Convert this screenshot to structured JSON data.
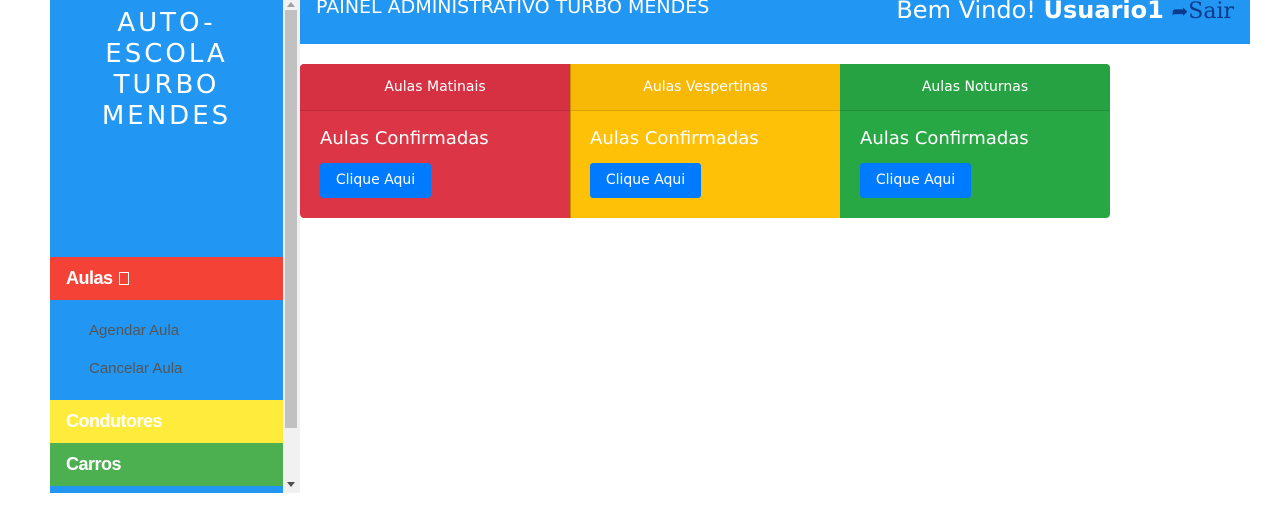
{
  "sidebar": {
    "brand_lines": [
      "AUTO-",
      "ESCOLA",
      "TURBO",
      "MENDES"
    ],
    "menu": {
      "aulas": "Aulas",
      "aulas_icon": "square-icon",
      "submenu": [
        "Agendar Aula",
        "Cancelar Aula"
      ],
      "condutores": "Condutores",
      "carros": "Carros"
    }
  },
  "header": {
    "title": "PAINEL ADMINISTRATIVO TURBO MENDES",
    "welcome": "Bem Vindo!",
    "user": "Usuario1",
    "logout_icon": "sign-out-icon",
    "logout": "Sair"
  },
  "cards": [
    {
      "header": "Aulas Matinais",
      "title": "Aulas Confirmadas",
      "button": "Clique Aqui",
      "color": "#dc3545"
    },
    {
      "header": "Aulas Vespertinas",
      "title": "Aulas Confirmadas",
      "button": "Clique Aqui",
      "color": "#ffc107"
    },
    {
      "header": "Aulas Noturnas",
      "title": "Aulas Confirmadas",
      "button": "Clique Aqui",
      "color": "#28a745"
    }
  ],
  "colors": {
    "primary": "#2196f3",
    "aulas_menu": "#f44336",
    "condutores_menu": "#ffeb3b",
    "carros_menu": "#4caf50",
    "button": "#007bff"
  }
}
